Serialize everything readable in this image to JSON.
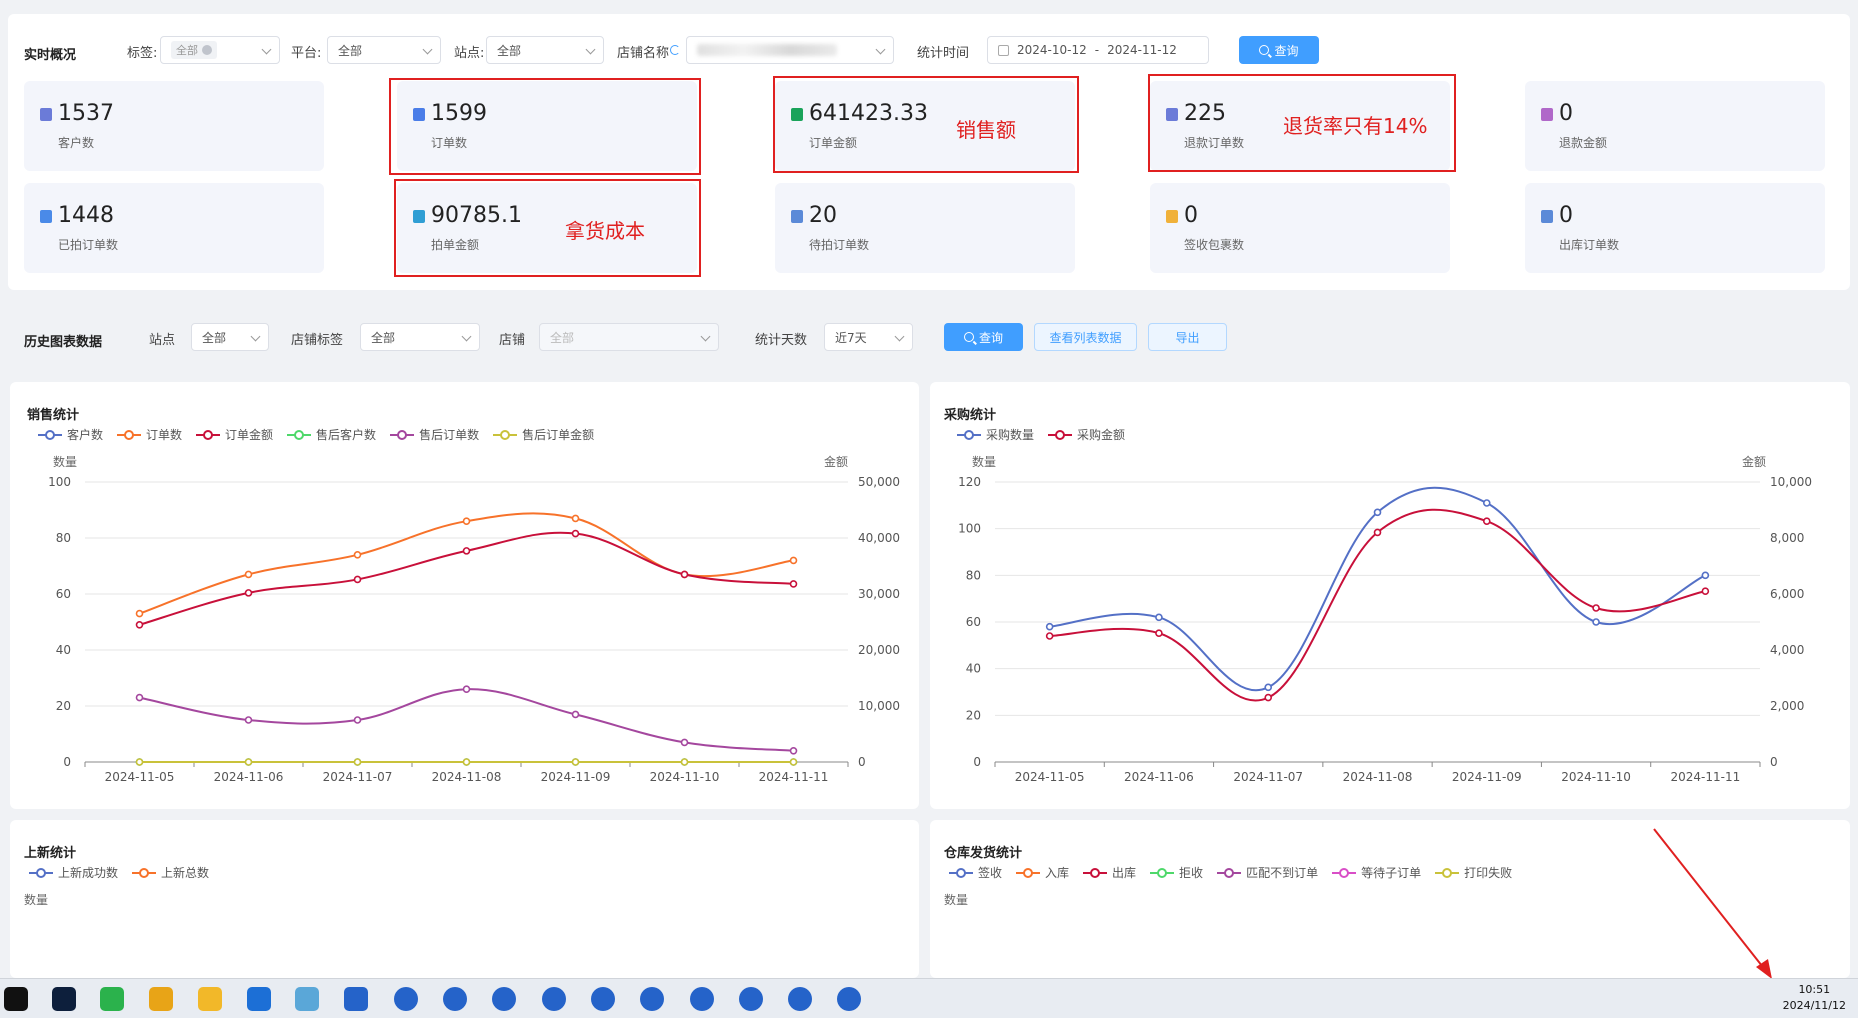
{
  "realtime": {
    "title": "实时概况",
    "filters": {
      "tag_label": "标签:",
      "tag_value": "全部",
      "platform_label": "平台:",
      "platform_value": "全部",
      "site_label": "站点:",
      "site_value": "全部",
      "shop_label": "店铺名称",
      "date_label": "统计时间",
      "date_start": "2024-10-12",
      "date_sep": "-",
      "date_end": "2024-11-12",
      "query_label": "查询"
    },
    "cards": [
      {
        "value": "1537",
        "label": "客户数",
        "icon_color": "#6b7bd8"
      },
      {
        "value": "1599",
        "label": "订单数",
        "icon_color": "#4a7de8"
      },
      {
        "value": "641423.33",
        "label": "订单金额",
        "icon_color": "#1aa35a"
      },
      {
        "value": "225",
        "label": "退款订单数",
        "icon_color": "#6b7bd8"
      },
      {
        "value": "0",
        "label": "退款金额",
        "icon_color": "#b068c9"
      },
      {
        "value": "1448",
        "label": "已拍订单数",
        "icon_color": "#4a8ae8"
      },
      {
        "value": "90785.1",
        "label": "拍单金额",
        "icon_color": "#2f9ed4"
      },
      {
        "value": "20",
        "label": "待拍订单数",
        "icon_color": "#5b8ad8"
      },
      {
        "value": "0",
        "label": "签收包裹数",
        "icon_color": "#f0b13a"
      },
      {
        "value": "0",
        "label": "出库订单数",
        "icon_color": "#5b8ad8"
      }
    ],
    "annotations": {
      "sales": "销售额",
      "refund": "退货率只有14%",
      "cost": "拿货成本"
    }
  },
  "history": {
    "title": "历史图表数据",
    "site_label": "站点",
    "site_value": "全部",
    "shop_tag_label": "店铺标签",
    "shop_tag_value": "全部",
    "shop_label": "店铺",
    "shop_value": "全部",
    "days_label": "统计天数",
    "days_value": "近7天",
    "query_label": "查询",
    "view_list_label": "查看列表数据",
    "export_label": "导出"
  },
  "chart_data": [
    {
      "type": "line",
      "title": "销售统计",
      "ylabel": "数量",
      "ylabel_right": "金额",
      "ylim": [
        0,
        100
      ],
      "ylim_right": [
        0,
        50000
      ],
      "yticks": [
        0,
        20,
        40,
        60,
        80,
        100
      ],
      "yticks_right": [
        "0",
        "10,000",
        "20,000",
        "30,000",
        "40,000",
        "50,000"
      ],
      "x": [
        "2024-11-05",
        "2024-11-06",
        "2024-11-07",
        "2024-11-08",
        "2024-11-09",
        "2024-11-10",
        "2024-11-11"
      ],
      "series": [
        {
          "name": "客户数",
          "axis": "left",
          "color": "#5470c6",
          "values": [
            0,
            0,
            0,
            0,
            0,
            0,
            0
          ]
        },
        {
          "name": "订单数",
          "axis": "left",
          "color": "#f7722a",
          "values": [
            53,
            67,
            74,
            86,
            87,
            67,
            72
          ]
        },
        {
          "name": "订单金额",
          "axis": "right",
          "color": "#c8103a",
          "values": [
            24500,
            30200,
            32600,
            37700,
            40800,
            33500,
            31800
          ]
        },
        {
          "name": "售后客户数",
          "axis": "left",
          "color": "#4ed86a",
          "values": [
            0,
            0,
            0,
            0,
            0,
            0,
            0
          ]
        },
        {
          "name": "售后订单数",
          "axis": "left",
          "color": "#a4479e",
          "values": [
            23,
            15,
            15,
            26,
            17,
            7,
            4
          ]
        },
        {
          "name": "售后订单金额",
          "axis": "right",
          "color": "#c9c23a",
          "values": [
            0,
            0,
            0,
            0,
            0,
            0,
            0
          ]
        }
      ]
    },
    {
      "type": "line",
      "title": "采购统计",
      "ylabel": "数量",
      "ylabel_right": "金额",
      "ylim": [
        0,
        120
      ],
      "ylim_right": [
        0,
        10000
      ],
      "yticks": [
        0,
        20,
        40,
        60,
        80,
        100,
        120
      ],
      "yticks_right": [
        "0",
        "2,000",
        "4,000",
        "6,000",
        "8,000",
        "10,000"
      ],
      "x": [
        "2024-11-05",
        "2024-11-06",
        "2024-11-07",
        "2024-11-08",
        "2024-11-09",
        "2024-11-10",
        "2024-11-11"
      ],
      "series": [
        {
          "name": "采购数量",
          "axis": "left",
          "color": "#5470c6",
          "values": [
            58,
            62,
            32,
            107,
            111,
            60,
            80
          ]
        },
        {
          "name": "采购金额",
          "axis": "right",
          "color": "#c8103a",
          "values": [
            4500,
            4600,
            2300,
            8200,
            8600,
            5500,
            6100
          ]
        }
      ]
    },
    {
      "type": "line",
      "title": "上新统计",
      "ylabel": "数量",
      "series": [
        {
          "name": "上新成功数",
          "color": "#5470c6",
          "values": []
        },
        {
          "name": "上新总数",
          "color": "#f7722a",
          "values": []
        }
      ]
    },
    {
      "type": "line",
      "title": "仓库发货统计",
      "ylabel": "数量",
      "series": [
        {
          "name": "签收",
          "color": "#5470c6",
          "values": []
        },
        {
          "name": "入库",
          "color": "#f7722a",
          "values": []
        },
        {
          "name": "出库",
          "color": "#c8103a",
          "values": []
        },
        {
          "name": "拒收",
          "color": "#4ed86a",
          "values": []
        },
        {
          "name": "匹配不到订单",
          "color": "#a4479e",
          "values": []
        },
        {
          "name": "等待子订单",
          "color": "#d94ec7",
          "values": []
        },
        {
          "name": "打印失败",
          "color": "#c9c23a",
          "values": []
        }
      ]
    }
  ],
  "taskbar": {
    "time": "10:51",
    "date": "2024/11/12",
    "apps": [
      {
        "name": "capcut-icon",
        "color": "#111111"
      },
      {
        "name": "photoshop-icon",
        "color": "#0d1f3c"
      },
      {
        "name": "wechat-icon",
        "color": "#2bb24c"
      },
      {
        "name": "chrome-icon",
        "color": "#e8a417"
      },
      {
        "name": "folder-icon",
        "color": "#f2b829"
      },
      {
        "name": "app-icon",
        "color": "#1c6fd6"
      },
      {
        "name": "notepad-icon",
        "color": "#5aa7d8"
      },
      {
        "name": "browser-icon",
        "color": "#2563c9"
      }
    ]
  }
}
